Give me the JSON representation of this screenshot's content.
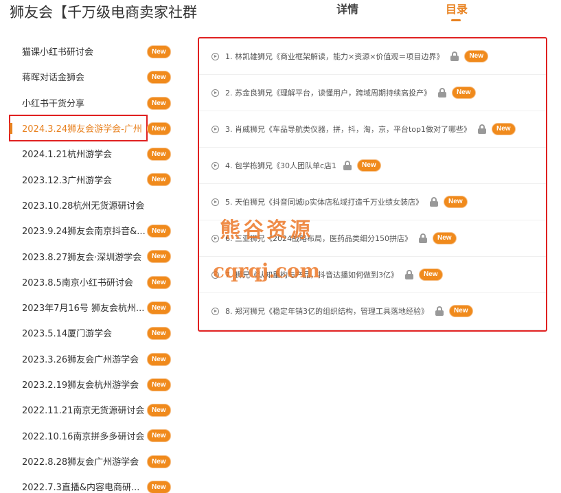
{
  "header": {
    "title": "狮友会【千万级电商卖家社群",
    "tabs": [
      {
        "label": "详情",
        "active": false
      },
      {
        "label": "目录",
        "active": true
      }
    ]
  },
  "sidebar": {
    "items": [
      {
        "label": "猫课小红书研讨会",
        "new": "New",
        "active": false
      },
      {
        "label": "蒋晖对话金狮会",
        "new": "New",
        "active": false
      },
      {
        "label": "小红书干货分享",
        "new": "New",
        "active": false
      },
      {
        "label": "2024.3.24狮友会游学会-广州",
        "new": "New",
        "active": true
      },
      {
        "label": "2024.1.21杭州游学会",
        "new": "New",
        "active": false
      },
      {
        "label": "2023.12.3广州游学会",
        "new": "New",
        "active": false
      },
      {
        "label": "2023.10.28杭州无货源研讨会",
        "new": "",
        "active": false
      },
      {
        "label": "2023.9.24狮友会南京抖音&...",
        "new": "New",
        "active": false
      },
      {
        "label": "2023.8.27狮友会·深圳游学会",
        "new": "New",
        "active": false
      },
      {
        "label": "2023.8.5南京小红书研讨会",
        "new": "New",
        "active": false
      },
      {
        "label": "2023年7月16号 狮友会杭州...",
        "new": "New",
        "active": false
      },
      {
        "label": "2023.5.14厦门游学会",
        "new": "New",
        "active": false
      },
      {
        "label": "2023.3.26狮友会广州游学会",
        "new": "New",
        "active": false
      },
      {
        "label": "2023.2.19狮友会杭州游学会",
        "new": "New",
        "active": false
      },
      {
        "label": "2022.11.21南京无货源研讨会",
        "new": "New",
        "active": false
      },
      {
        "label": "2022.10.16南京拼多多研讨会",
        "new": "New",
        "active": false
      },
      {
        "label": "2022.8.28狮友会广州游学会",
        "new": "New",
        "active": false
      },
      {
        "label": "2022.7.3直播&内容电商研...",
        "new": "New",
        "active": false
      }
    ]
  },
  "toc": {
    "items": [
      {
        "label": "1. 林凯雄狮兄《商业框架解读，能力×资源×价值观＝项目边界》",
        "new": "New"
      },
      {
        "label": "2. 苏金良狮兄《理解平台，读懂用户，跨域周期持续高投产》",
        "new": "New"
      },
      {
        "label": "3. 肖威狮兄《车品导航类仪器，拼，抖，淘，京，平台top1做对了哪些》",
        "new": "New"
      },
      {
        "label": "4. 包学栋狮兄《30人团队单c店1",
        "new": "New"
      },
      {
        "label": "5. 天伯狮兄《抖音同城ip实体店私域打造千万业绩女装店》",
        "new": "New"
      },
      {
        "label": "6. 三亚狮兄《2024战略布局，医药品类细分150拼店》",
        "new": "New"
      },
      {
        "label": "7. 狮兄《认知重构与产品，抖音达播如何做到3亿》",
        "new": "New"
      },
      {
        "label": "8. 郑河狮兄《稳定年销3亿的组织结构，管理工具落地经验》",
        "new": "New"
      }
    ]
  },
  "watermark": {
    "line1": "熊谷资源",
    "line2": "cqrqj.com"
  },
  "colors": {
    "accent": "#e8811f",
    "badge": "#f08a1c",
    "highlight_border": "#e02020"
  }
}
